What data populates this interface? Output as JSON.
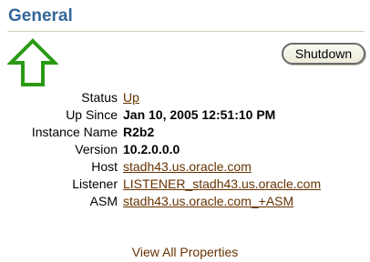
{
  "section": {
    "title": "General"
  },
  "shutdown_button": {
    "label": "Shutdown"
  },
  "status_icon": {
    "name": "up-arrow-icon",
    "color": "#2a9a14"
  },
  "properties": {
    "status": {
      "label": "Status",
      "value": "Up"
    },
    "up_since": {
      "label": "Up Since",
      "value": "Jan 10, 2005 12:51:10 PM"
    },
    "instance_name": {
      "label": "Instance Name",
      "value": "R2b2"
    },
    "version": {
      "label": "Version",
      "value": "10.2.0.0.0"
    },
    "host": {
      "label": "Host",
      "value": "stadh43.us.oracle.com"
    },
    "listener": {
      "label": "Listener",
      "value": "LISTENER_stadh43.us.oracle.com"
    },
    "asm": {
      "label": "ASM",
      "value": "stadh43.us.oracle.com_+ASM"
    }
  },
  "view_all": {
    "label": "View All Properties"
  },
  "colors": {
    "title": "#336699",
    "link": "#663300",
    "rule": "#cfd9c2"
  }
}
